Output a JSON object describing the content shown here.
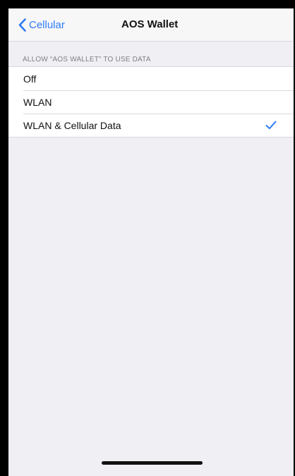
{
  "nav": {
    "back_label": "Cellular",
    "title": "AOS Wallet"
  },
  "section": {
    "header": "ALLOW “AOS WALLET” TO USE DATA"
  },
  "options": [
    {
      "label": "Off",
      "selected": false
    },
    {
      "label": "WLAN",
      "selected": false
    },
    {
      "label": "WLAN & Cellular Data",
      "selected": true
    }
  ],
  "colors": {
    "accent": "#2f7cf6",
    "background": "#efeff4"
  },
  "icons": {
    "back": "chevron-left-icon",
    "selected": "checkmark-icon"
  }
}
